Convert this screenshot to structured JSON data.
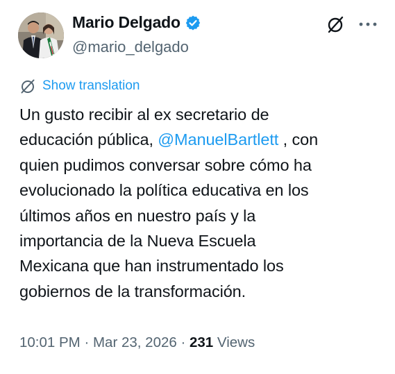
{
  "author": {
    "display_name": "Mario Delgado",
    "handle": "@mario_delgado",
    "verified": true,
    "avatar_icon": "profile-photo",
    "badge_color": "#1d9bf0"
  },
  "actions": {
    "grok_icon": "slashed-circle-icon",
    "more_icon": "more-horizontal-icon",
    "more_label": "···"
  },
  "translation": {
    "icon": "translate-globe-icon",
    "label": "Show translation"
  },
  "tweet": {
    "lines": [
      {
        "before": "Un gusto recibir al ex secretario de",
        "mention": "",
        "after": ""
      },
      {
        "before": "educación pública, ",
        "mention": "@ManuelBartlett",
        "after": " , con"
      },
      {
        "before": "quien pudimos conversar sobre cómo ha",
        "mention": "",
        "after": ""
      },
      {
        "before": "evolucionado la política educativa en los",
        "mention": "",
        "after": ""
      },
      {
        "before": "últimos años en nuestro país y la",
        "mention": "",
        "after": ""
      },
      {
        "before": "importancia de la Nueva Escuela",
        "mention": "",
        "after": ""
      },
      {
        "before": "Mexicana que han instrumentado los",
        "mention": "",
        "after": ""
      },
      {
        "before": "gobiernos de la transformación.",
        "mention": "",
        "after": ""
      }
    ]
  },
  "meta": {
    "time": "10:01 PM",
    "separator": " · ",
    "date": "Mar 23, 2026",
    "views_count": "231",
    "views_label": " Views"
  },
  "colors": {
    "link": "#1d9bf0",
    "text_primary": "#0f1419",
    "text_secondary": "#536471",
    "background": "#ffffff"
  }
}
